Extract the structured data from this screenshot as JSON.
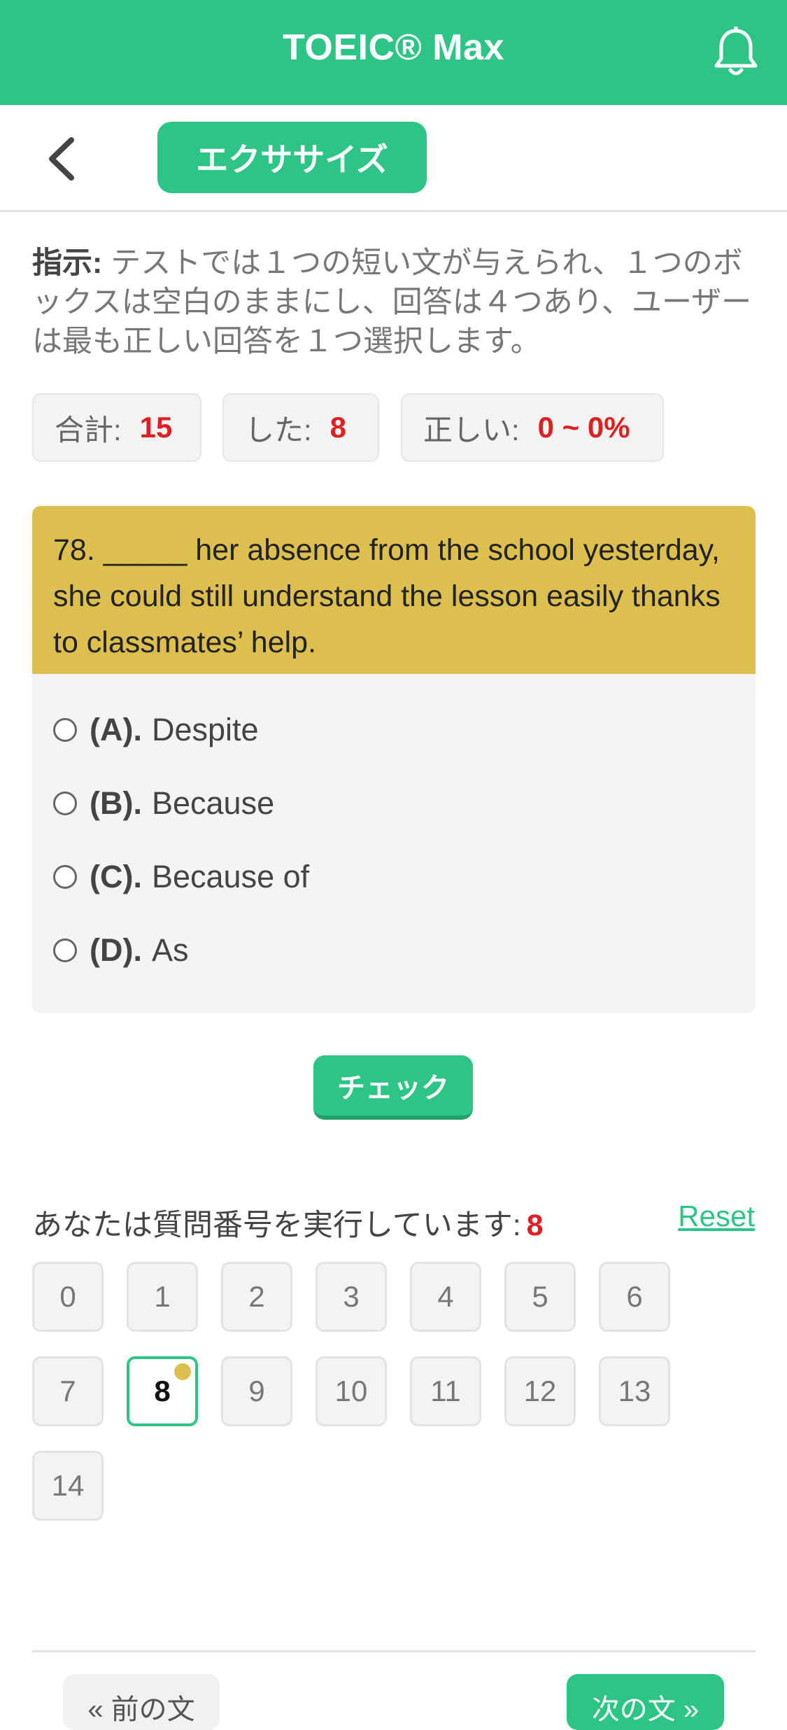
{
  "header": {
    "title": "TOEIC® Max",
    "bell_icon": "bell-icon",
    "brand_color": "#2ec486"
  },
  "subheader": {
    "back_icon": "chevron-left-icon",
    "exercise_label": "エクササイズ"
  },
  "instructions": {
    "label": "指示:",
    "text": " テストでは１つの短い文が与えられ、１つのボックスは空白のままにし、回答は４つあり、ユーザーは最も正しい回答を１つ選択します。"
  },
  "stats": {
    "total_label": "合計:",
    "total_value": "15",
    "done_label": "した:",
    "done_value": "8",
    "correct_label": "正しい:",
    "correct_value": "0 ~ 0%"
  },
  "question": {
    "text": "78. _____ her absence from the school yesterday, she could still understand the lesson easily thanks to classmates’ help.",
    "options": [
      {
        "letter": "(A).",
        "text": "Despite"
      },
      {
        "letter": "(B).",
        "text": "Because"
      },
      {
        "letter": "(C).",
        "text": "Because of"
      },
      {
        "letter": "(D).",
        "text": "As"
      }
    ],
    "highlight_color": "#dcbf4e"
  },
  "check_label": "チェック",
  "progress": {
    "label": "あなたは質問番号を実行しています:",
    "current": "8",
    "reset_label": "Reset"
  },
  "questions": [
    "0",
    "1",
    "2",
    "3",
    "4",
    "5",
    "6",
    "7",
    "8",
    "9",
    "10",
    "11",
    "12",
    "13",
    "14"
  ],
  "nav": {
    "prev_label": "« 前の文",
    "next_label": "次の文 »"
  }
}
